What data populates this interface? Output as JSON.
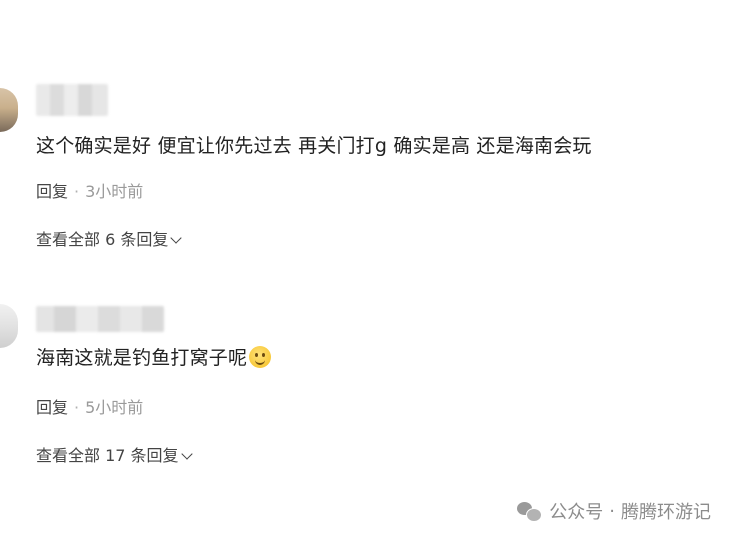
{
  "comments": [
    {
      "text": "这个确实是好 便宜让你先过去 再关门打g 确实是高 还是海南会玩",
      "reply_label": "回复",
      "separator": "·",
      "time": "3小时前",
      "view_replies": "查看全部 6 条回复"
    },
    {
      "text": "海南这就是钓鱼打窝子呢",
      "reply_label": "回复",
      "separator": "·",
      "time": "5小时前",
      "view_replies": "查看全部 17 条回复"
    }
  ],
  "watermark": {
    "source": "公众号",
    "separator": "·",
    "account": "腾腾环游记"
  },
  "icons": {
    "emoji": "smiling-face-icon",
    "chevron": "chevron-down-icon",
    "watermark": "wechat-icon"
  }
}
